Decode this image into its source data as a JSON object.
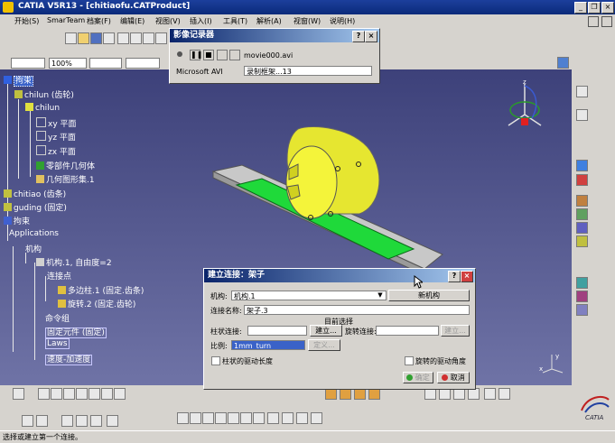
{
  "window": {
    "title": "CATIA V5R13 - [chitiaofu.CATProduct]",
    "minimize": "_",
    "restore": "❐",
    "close": "×"
  },
  "menu": [
    "开始(S)",
    "SmarTeam",
    "档案(F)",
    "编辑(E)",
    "视图(V)",
    "插入(I)",
    "工具(T)",
    "解析(A)",
    "视窗(W)",
    "说明(H)"
  ],
  "toolbar": {
    "zoom_value": "100%"
  },
  "recorder": {
    "title": "影像记录器",
    "help": "?",
    "close": "×",
    "file_name": "movie000.avi",
    "codec_label": "Microsoft AVI",
    "codec_value": "录制框架...13"
  },
  "tree": {
    "root": "拘束",
    "chilun": "chilun (齿轮)",
    "chilun_part": "chilun",
    "xy": "xy 平面",
    "yz": "yz 平面",
    "zx": "zx 平面",
    "partbody": "零部件几何体",
    "geoset": "几何图形集.1",
    "chitiao": "chitiao (齿条)",
    "guding": "guding (固定)",
    "constraints": "拘束",
    "applications": "Applications",
    "mechanisms": "机构",
    "mech1": "机构.1, 自由度=2",
    "joints": "连接点",
    "joint1": "多边柱.1 (固定.齿条)",
    "joint2": "旋转.2 (固定.齿轮)",
    "commands": "命令组",
    "fixed": "固定元件 (固定)",
    "laws": "Laws",
    "speed": "速度-加速度"
  },
  "joint_dialog": {
    "title": "建立连接：架子",
    "help": "?",
    "close": "×",
    "mechanism_label": "机构:",
    "mechanism_value": "机构.1",
    "new_mechanism": "新机构",
    "joint_name_label": "连接名称:",
    "joint_name_value": "架子.3",
    "current_selection": "目前选择",
    "cylinder_label": "柱状连接:",
    "create_button": "建立...",
    "rotation_label": "旋转连接:",
    "rotation_button": "建立...",
    "ratio_label": "比例:",
    "ratio_value": "1mm_turn",
    "formula_button": "定义...",
    "cylinder_driven": "柱状的驱动长度",
    "rotation_driven": "旋转的驱动角度",
    "ok": "确定",
    "cancel": "取消"
  },
  "compass_axes": {
    "x": "x",
    "y": "y",
    "z": "z"
  },
  "brand": "CATIA",
  "status": "选择或建立第一个连接。"
}
